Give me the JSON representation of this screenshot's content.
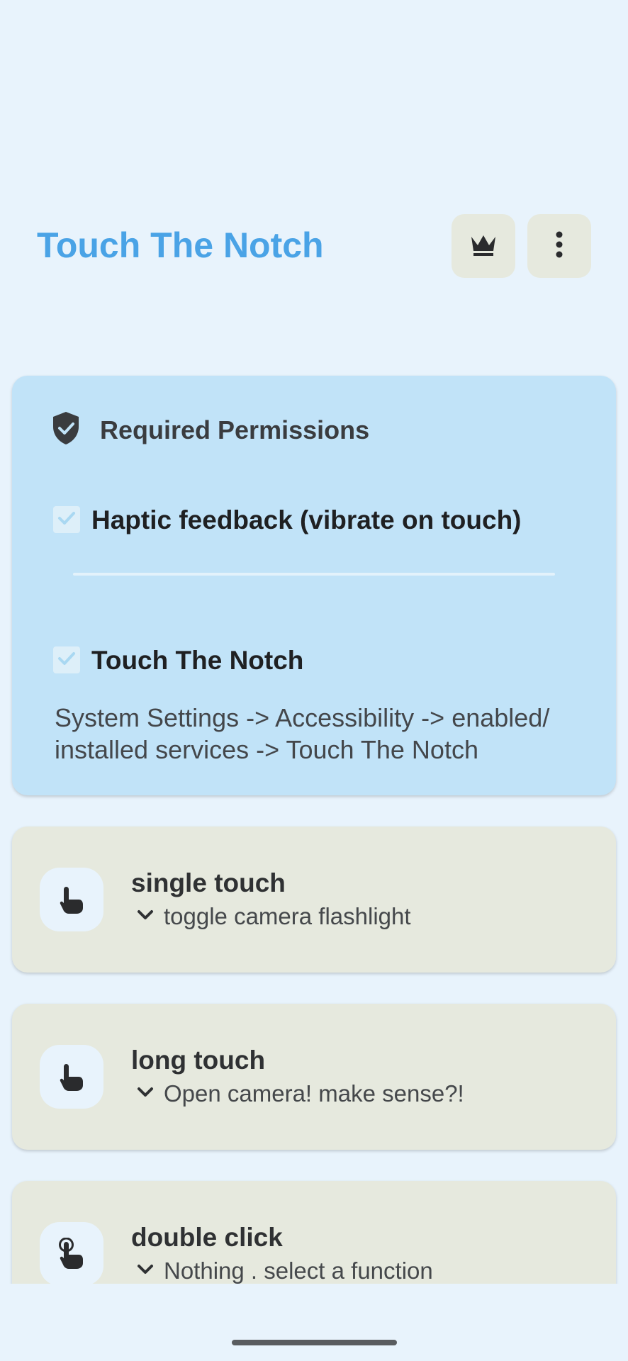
{
  "header": {
    "title": "Touch The Notch",
    "premium_icon": "crown-icon",
    "menu_icon": "more-vertical-icon"
  },
  "permissions": {
    "icon": "shield-check-icon",
    "title": "Required Permissions",
    "items": [
      {
        "label": "Haptic feedback (vibrate on touch)",
        "checked": true
      },
      {
        "label": "Touch The Notch",
        "checked": true
      }
    ],
    "description": "System Settings -> Accessibility -> enabled/ installed services -> Touch The Notch"
  },
  "actions": [
    {
      "icon": "touch-icon",
      "title": "single touch",
      "value": "toggle camera flashlight"
    },
    {
      "icon": "touch-icon",
      "title": "long touch",
      "value": "Open camera! make sense?!"
    },
    {
      "icon": "double-tap-icon",
      "title": "double click",
      "value": "Nothing . select a function"
    }
  ],
  "colors": {
    "background": "#e8f3fc",
    "accent": "#4aa3e6",
    "permission_card": "#c1e3f8",
    "action_card": "#e6e9de"
  }
}
